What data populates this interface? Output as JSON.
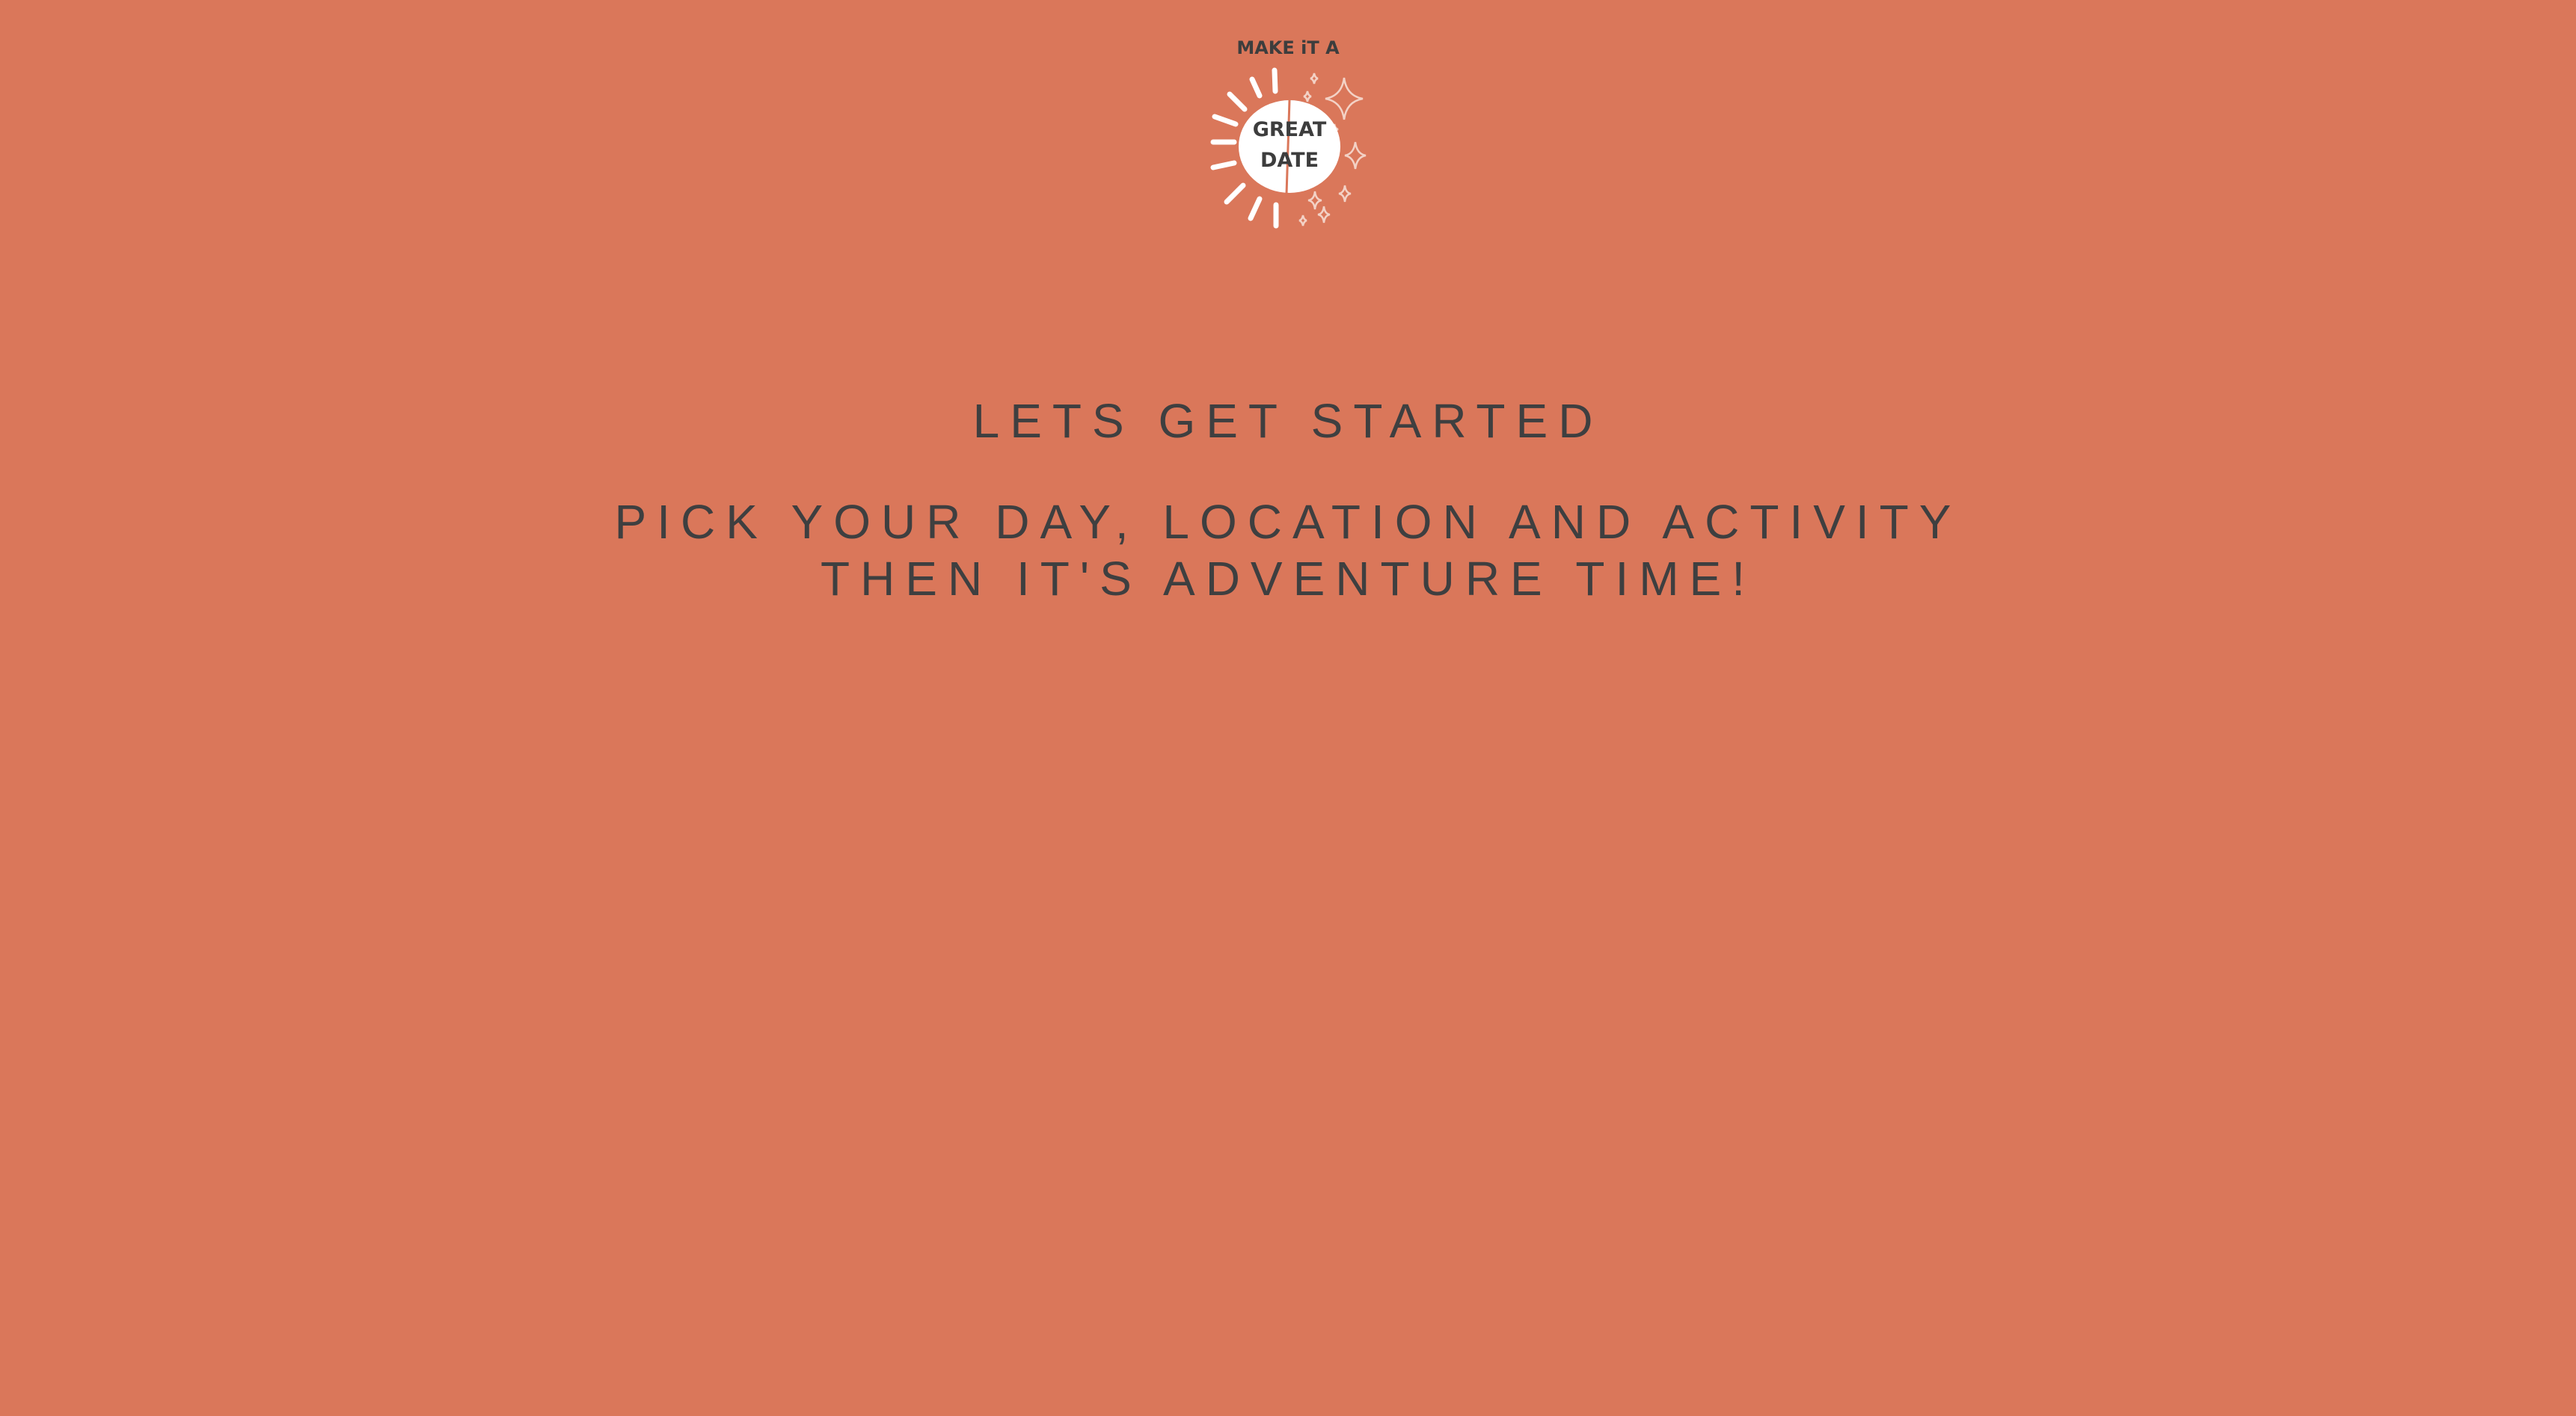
{
  "logo": {
    "icon": "sun-badge-icon",
    "top_text": "MAKE iT A",
    "line1": "GREAT",
    "line2": "DATE"
  },
  "hero": {
    "heading": "LETS GET STARTED",
    "subtitle_line1": "PICK YOUR DAY, LOCATION AND ACTIVITY",
    "subtitle_line2": "THEN IT'S ADVENTURE TIME!"
  },
  "colors": {
    "background": "#da775a",
    "text": "#3e3f40",
    "logo_white": "#ffffff"
  }
}
